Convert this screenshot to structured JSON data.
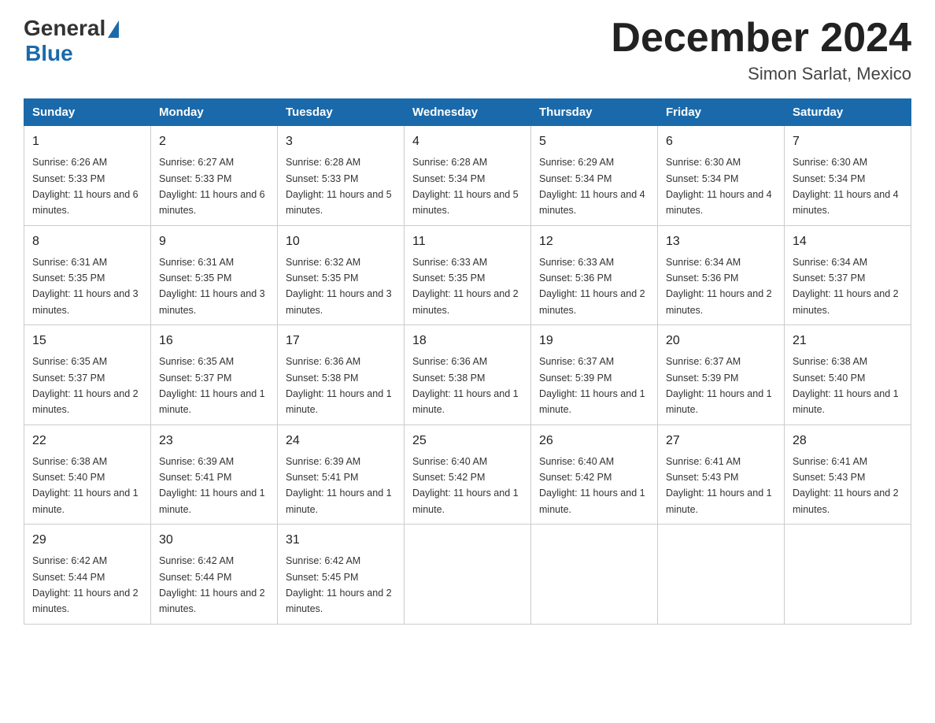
{
  "logo": {
    "general": "General",
    "blue": "Blue"
  },
  "title": "December 2024",
  "subtitle": "Simon Sarlat, Mexico",
  "days_of_week": [
    "Sunday",
    "Monday",
    "Tuesday",
    "Wednesday",
    "Thursday",
    "Friday",
    "Saturday"
  ],
  "weeks": [
    [
      {
        "num": "1",
        "sunrise": "6:26 AM",
        "sunset": "5:33 PM",
        "daylight": "11 hours and 6 minutes."
      },
      {
        "num": "2",
        "sunrise": "6:27 AM",
        "sunset": "5:33 PM",
        "daylight": "11 hours and 6 minutes."
      },
      {
        "num": "3",
        "sunrise": "6:28 AM",
        "sunset": "5:33 PM",
        "daylight": "11 hours and 5 minutes."
      },
      {
        "num": "4",
        "sunrise": "6:28 AM",
        "sunset": "5:34 PM",
        "daylight": "11 hours and 5 minutes."
      },
      {
        "num": "5",
        "sunrise": "6:29 AM",
        "sunset": "5:34 PM",
        "daylight": "11 hours and 4 minutes."
      },
      {
        "num": "6",
        "sunrise": "6:30 AM",
        "sunset": "5:34 PM",
        "daylight": "11 hours and 4 minutes."
      },
      {
        "num": "7",
        "sunrise": "6:30 AM",
        "sunset": "5:34 PM",
        "daylight": "11 hours and 4 minutes."
      }
    ],
    [
      {
        "num": "8",
        "sunrise": "6:31 AM",
        "sunset": "5:35 PM",
        "daylight": "11 hours and 3 minutes."
      },
      {
        "num": "9",
        "sunrise": "6:31 AM",
        "sunset": "5:35 PM",
        "daylight": "11 hours and 3 minutes."
      },
      {
        "num": "10",
        "sunrise": "6:32 AM",
        "sunset": "5:35 PM",
        "daylight": "11 hours and 3 minutes."
      },
      {
        "num": "11",
        "sunrise": "6:33 AM",
        "sunset": "5:35 PM",
        "daylight": "11 hours and 2 minutes."
      },
      {
        "num": "12",
        "sunrise": "6:33 AM",
        "sunset": "5:36 PM",
        "daylight": "11 hours and 2 minutes."
      },
      {
        "num": "13",
        "sunrise": "6:34 AM",
        "sunset": "5:36 PM",
        "daylight": "11 hours and 2 minutes."
      },
      {
        "num": "14",
        "sunrise": "6:34 AM",
        "sunset": "5:37 PM",
        "daylight": "11 hours and 2 minutes."
      }
    ],
    [
      {
        "num": "15",
        "sunrise": "6:35 AM",
        "sunset": "5:37 PM",
        "daylight": "11 hours and 2 minutes."
      },
      {
        "num": "16",
        "sunrise": "6:35 AM",
        "sunset": "5:37 PM",
        "daylight": "11 hours and 1 minute."
      },
      {
        "num": "17",
        "sunrise": "6:36 AM",
        "sunset": "5:38 PM",
        "daylight": "11 hours and 1 minute."
      },
      {
        "num": "18",
        "sunrise": "6:36 AM",
        "sunset": "5:38 PM",
        "daylight": "11 hours and 1 minute."
      },
      {
        "num": "19",
        "sunrise": "6:37 AM",
        "sunset": "5:39 PM",
        "daylight": "11 hours and 1 minute."
      },
      {
        "num": "20",
        "sunrise": "6:37 AM",
        "sunset": "5:39 PM",
        "daylight": "11 hours and 1 minute."
      },
      {
        "num": "21",
        "sunrise": "6:38 AM",
        "sunset": "5:40 PM",
        "daylight": "11 hours and 1 minute."
      }
    ],
    [
      {
        "num": "22",
        "sunrise": "6:38 AM",
        "sunset": "5:40 PM",
        "daylight": "11 hours and 1 minute."
      },
      {
        "num": "23",
        "sunrise": "6:39 AM",
        "sunset": "5:41 PM",
        "daylight": "11 hours and 1 minute."
      },
      {
        "num": "24",
        "sunrise": "6:39 AM",
        "sunset": "5:41 PM",
        "daylight": "11 hours and 1 minute."
      },
      {
        "num": "25",
        "sunrise": "6:40 AM",
        "sunset": "5:42 PM",
        "daylight": "11 hours and 1 minute."
      },
      {
        "num": "26",
        "sunrise": "6:40 AM",
        "sunset": "5:42 PM",
        "daylight": "11 hours and 1 minute."
      },
      {
        "num": "27",
        "sunrise": "6:41 AM",
        "sunset": "5:43 PM",
        "daylight": "11 hours and 1 minute."
      },
      {
        "num": "28",
        "sunrise": "6:41 AM",
        "sunset": "5:43 PM",
        "daylight": "11 hours and 2 minutes."
      }
    ],
    [
      {
        "num": "29",
        "sunrise": "6:42 AM",
        "sunset": "5:44 PM",
        "daylight": "11 hours and 2 minutes."
      },
      {
        "num": "30",
        "sunrise": "6:42 AM",
        "sunset": "5:44 PM",
        "daylight": "11 hours and 2 minutes."
      },
      {
        "num": "31",
        "sunrise": "6:42 AM",
        "sunset": "5:45 PM",
        "daylight": "11 hours and 2 minutes."
      },
      null,
      null,
      null,
      null
    ]
  ]
}
